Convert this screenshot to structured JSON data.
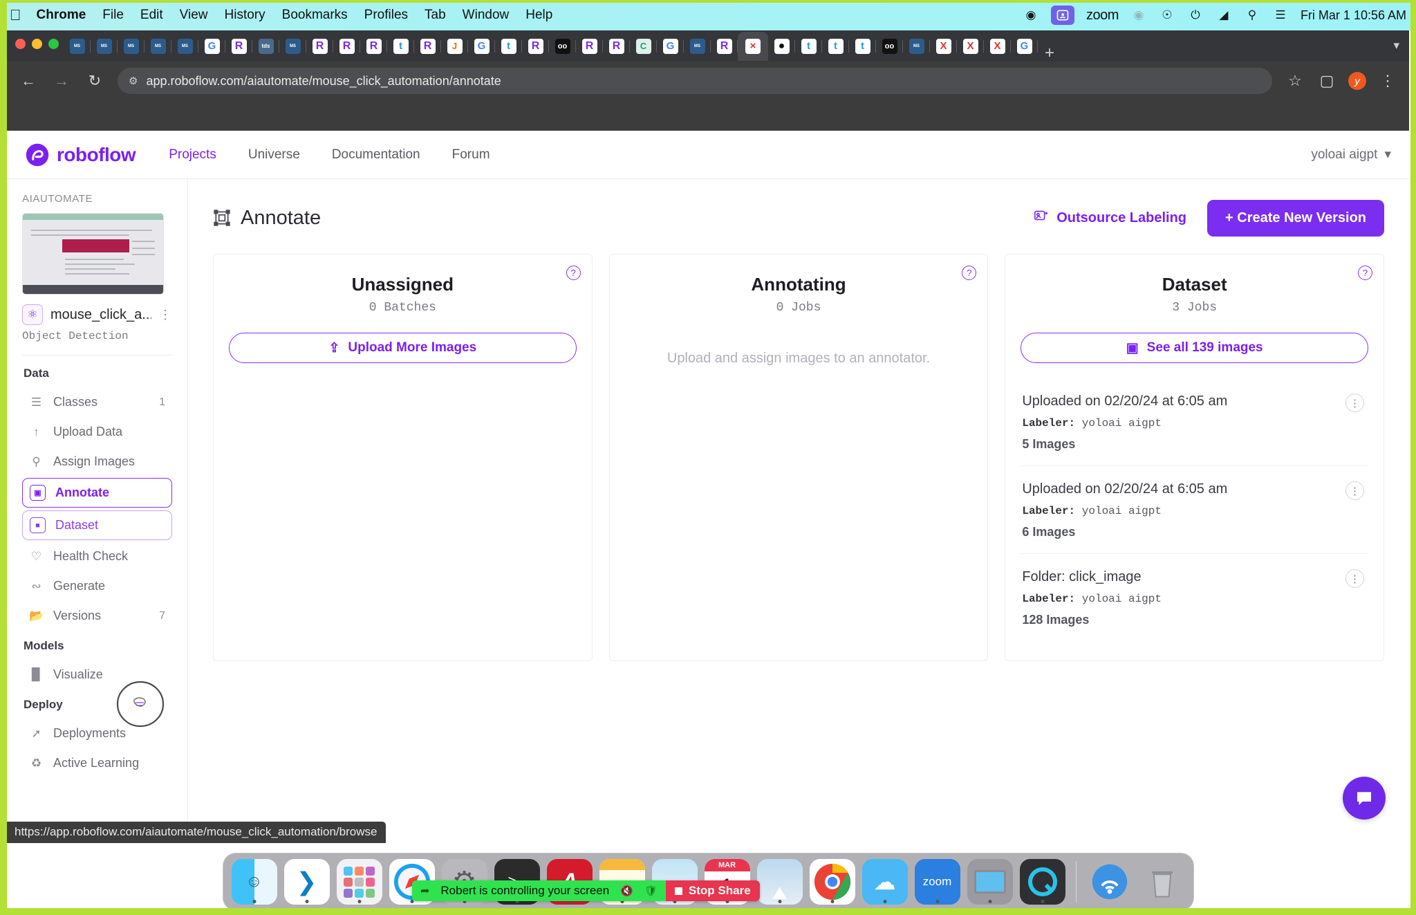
{
  "menubar": {
    "apple_icon": "apple-icon",
    "items": [
      "Chrome",
      "File",
      "Edit",
      "View",
      "History",
      "Bookmarks",
      "Profiles",
      "Tab",
      "Window",
      "Help"
    ],
    "zoom_label": "zoom",
    "clock": "Fri Mar 1  10:56 AM",
    "status_icons": [
      "dropbox-icon",
      "zoom-video-icon",
      "airplay-icon",
      "do-not-disturb-icon",
      "battery-icon",
      "wifi-icon",
      "search-icon",
      "control-center-icon"
    ]
  },
  "browser": {
    "back_icon": "back-arrow-icon",
    "forward_icon": "forward-arrow-icon",
    "reload_icon": "reload-icon",
    "site_info_icon": "site-settings-icon",
    "url": "app.roboflow.com/aiautomate/mouse_click_automation/annotate",
    "bookmark_icon": "star-icon",
    "sidepanel_icon": "side-panel-icon",
    "profile_initial": "y",
    "menu_icon": "three-dot-menu-icon",
    "new_tab_icon": "plus-icon",
    "tab_list_icon": "chevron-down-icon",
    "tabs": [
      {
        "favicon": "morgan-stanley-icon",
        "cls": "fv-ms",
        "glyph": "Morgan Stanley"
      },
      {
        "favicon": "morgan-stanley-icon",
        "cls": "fv-ms",
        "glyph": "Morgan Stanley"
      },
      {
        "favicon": "morgan-stanley-icon",
        "cls": "fv-ms",
        "glyph": "Morgan Stanley"
      },
      {
        "favicon": "morgan-stanley-icon",
        "cls": "fv-ms",
        "glyph": "Morgan Stanley"
      },
      {
        "favicon": "morgan-stanley-icon",
        "cls": "fv-ms",
        "glyph": "Morgan Stanley"
      },
      {
        "favicon": "google-icon",
        "cls": "fv-g",
        "glyph": "G"
      },
      {
        "favicon": "roboflow-icon",
        "cls": "fv-rf",
        "glyph": "R"
      },
      {
        "favicon": "tds-icon",
        "cls": "fv-tds",
        "glyph": "tds"
      },
      {
        "favicon": "morgan-stanley-icon",
        "cls": "fv-ms",
        "glyph": "Morgan Stanley"
      },
      {
        "favicon": "roboflow-icon",
        "cls": "fv-rf",
        "glyph": "R"
      },
      {
        "favicon": "roboflow-icon",
        "cls": "fv-rf",
        "glyph": "R"
      },
      {
        "favicon": "roboflow-icon",
        "cls": "fv-rf",
        "glyph": "R"
      },
      {
        "favicon": "twitter-icon",
        "cls": "fv-tw",
        "glyph": "t"
      },
      {
        "favicon": "roboflow-icon",
        "cls": "fv-rf",
        "glyph": "R"
      },
      {
        "favicon": "java-icon",
        "cls": "fv-java",
        "glyph": "J"
      },
      {
        "favicon": "google-icon",
        "cls": "fv-g",
        "glyph": "G"
      },
      {
        "favicon": "twitter-icon",
        "cls": "fv-tw",
        "glyph": "t"
      },
      {
        "favicon": "roboflow-icon",
        "cls": "fv-rf",
        "glyph": "R"
      },
      {
        "favicon": "dark-icon",
        "cls": "fv-dk",
        "glyph": "oo"
      },
      {
        "favicon": "roboflow-icon",
        "cls": "fv-rf",
        "glyph": "R"
      },
      {
        "favicon": "roboflow-icon",
        "cls": "fv-rf",
        "glyph": "R"
      },
      {
        "favicon": "chatgpt-icon",
        "cls": "fv-cg",
        "glyph": "C"
      },
      {
        "favicon": "google-icon",
        "cls": "fv-g",
        "glyph": "G"
      },
      {
        "favicon": "morgan-stanley-icon",
        "cls": "fv-ms",
        "glyph": "Morgan Stanley"
      },
      {
        "favicon": "roboflow-icon",
        "cls": "fv-rf",
        "glyph": "R"
      },
      {
        "favicon": "active-tab-icon",
        "cls": "fv-x",
        "glyph": "×",
        "active": true
      },
      {
        "favicon": "github-icon",
        "cls": "fv-gh",
        "glyph": "●"
      },
      {
        "favicon": "twitter-icon",
        "cls": "fv-tw",
        "glyph": "t"
      },
      {
        "favicon": "twitter-icon",
        "cls": "fv-tw",
        "glyph": "t"
      },
      {
        "favicon": "twitter-icon",
        "cls": "fv-tw",
        "glyph": "t"
      },
      {
        "favicon": "dark-icon",
        "cls": "fv-dk",
        "glyph": "oo"
      },
      {
        "favicon": "morgan-stanley-icon",
        "cls": "fv-ms",
        "glyph": "Morgan Stanley"
      },
      {
        "favicon": "x-icon",
        "cls": "fv-x",
        "glyph": "X"
      },
      {
        "favicon": "x-icon",
        "cls": "fv-x",
        "glyph": "X"
      },
      {
        "favicon": "x-icon",
        "cls": "fv-x",
        "glyph": "X"
      },
      {
        "favicon": "google-icon",
        "cls": "fv-g",
        "glyph": "G"
      }
    ]
  },
  "topnav": {
    "brand": "roboflow",
    "links": [
      {
        "label": "Projects",
        "active": true
      },
      {
        "label": "Universe",
        "active": false
      },
      {
        "label": "Documentation",
        "active": false
      },
      {
        "label": "Forum",
        "active": false
      }
    ],
    "user": "yoloai aigpt",
    "user_chevron": "chevron-down-icon"
  },
  "sidebar": {
    "org": "AIAUTOMATE",
    "project_name": "mouse_click_a...",
    "project_type": "Object Detection",
    "project_icon": "globe-icon",
    "project_menu_icon": "three-dot-menu-icon",
    "sections": [
      {
        "title": "Data",
        "items": [
          {
            "label": "Classes",
            "icon": "list-icon",
            "count": "1",
            "state": "normal"
          },
          {
            "label": "Upload Data",
            "icon": "upload-arrow-icon",
            "count": "",
            "state": "normal"
          },
          {
            "label": "Assign Images",
            "icon": "search-icon",
            "count": "",
            "state": "normal"
          },
          {
            "label": "Annotate",
            "icon": "annotate-box-icon",
            "count": "",
            "state": "selected"
          },
          {
            "label": "Dataset",
            "icon": "dataset-image-icon",
            "count": "",
            "state": "selected-soft"
          },
          {
            "label": "Health Check",
            "icon": "heartbeat-icon",
            "count": "",
            "state": "normal"
          },
          {
            "label": "Generate",
            "icon": "generate-layers-icon",
            "count": "",
            "state": "normal"
          },
          {
            "label": "Versions",
            "icon": "folder-icon",
            "count": "7",
            "state": "normal"
          }
        ]
      },
      {
        "title": "Models",
        "items": [
          {
            "label": "Visualize",
            "icon": "bar-chart-icon",
            "count": "",
            "state": "normal"
          }
        ]
      },
      {
        "title": "Deploy",
        "items": [
          {
            "label": "Deployments",
            "icon": "rocket-icon",
            "count": "",
            "state": "normal"
          },
          {
            "label": "Active Learning",
            "icon": "recycle-icon",
            "count": "",
            "state": "normal"
          }
        ]
      }
    ]
  },
  "main": {
    "page_title": "Annotate",
    "page_title_icon": "annotate-box-icon",
    "outsource_label": "Outsource Labeling",
    "outsource_icon": "outsource-icon",
    "create_version_label": "+ Create New Version",
    "cards": [
      {
        "title": "Unassigned",
        "subtitle": "0 Batches",
        "help_icon": "question-mark-icon",
        "action_label": "Upload More Images",
        "action_icon": "upload-box-icon",
        "empty_message": ""
      },
      {
        "title": "Annotating",
        "subtitle": "0 Jobs",
        "help_icon": "question-mark-icon",
        "action_label": "",
        "action_icon": "",
        "empty_message": "Upload and assign images to an annotator."
      },
      {
        "title": "Dataset",
        "subtitle": "3 Jobs",
        "help_icon": "question-mark-icon",
        "action_label": "See all 139 images",
        "action_icon": "images-icon",
        "empty_message": ""
      }
    ],
    "dataset_jobs": [
      {
        "title": "Uploaded on 02/20/24 at 6:05 am",
        "labeler_label": "Labeler:",
        "labeler": "yoloai aigpt",
        "count": "5 Images",
        "menu_icon": "three-dot-menu-icon"
      },
      {
        "title": "Uploaded on 02/20/24 at 6:05 am",
        "labeler_label": "Labeler:",
        "labeler": "yoloai aigpt",
        "count": "6 Images",
        "menu_icon": "three-dot-menu-icon"
      },
      {
        "title": "Folder: click_image",
        "labeler_label": "Labeler:",
        "labeler": "yoloai aigpt",
        "count": "128 Images",
        "menu_icon": "three-dot-menu-icon"
      }
    ],
    "chat_icon": "chat-bubble-icon"
  },
  "statusbar": {
    "url": "https://app.roboflow.com/aiautomate/mouse_click_automation/browse"
  },
  "dock": {
    "items": [
      {
        "name": "finder-icon",
        "bg": "#2aa8f2",
        "glyph": ""
      },
      {
        "name": "vscode-icon",
        "bg": "#ffffff",
        "glyph": ""
      },
      {
        "name": "launchpad-icon",
        "bg": "#f2f2f4",
        "glyph": ""
      },
      {
        "name": "safari-icon",
        "bg": "#ffffff",
        "glyph": ""
      },
      {
        "name": "system-settings-icon",
        "bg": "#b9b9bd",
        "glyph": ""
      },
      {
        "name": "terminal-icon",
        "bg": "#2b2b2b",
        "glyph": ">_"
      },
      {
        "name": "adobe-acrobat-icon",
        "bg": "#d41b2c",
        "glyph": "A"
      },
      {
        "name": "notes-icon",
        "bg": "#fdf3c8",
        "glyph": ""
      },
      {
        "name": "preview-icon",
        "bg": "#cfe6f7",
        "glyph": ""
      },
      {
        "name": "calendar-icon",
        "bg": "#ffffff",
        "glyph": "1"
      },
      {
        "name": "photos-icon",
        "bg": "#dceaf5",
        "glyph": ""
      },
      {
        "name": "chrome-icon",
        "bg": "#ffffff",
        "glyph": ""
      },
      {
        "name": "weather-icon",
        "bg": "#45b6f5",
        "glyph": ""
      },
      {
        "name": "zoom-icon",
        "bg": "#2a7fe0",
        "glyph": "zoom"
      },
      {
        "name": "display-icon",
        "bg": "#9a9aa0",
        "glyph": ""
      },
      {
        "name": "quicktime-icon",
        "bg": "#2e2e33",
        "glyph": ""
      },
      {
        "name": "airdrop-icon",
        "bg": "transparent",
        "glyph": ""
      },
      {
        "name": "trash-icon",
        "bg": "transparent",
        "glyph": ""
      }
    ],
    "calendar_month": "MAR",
    "calendar_day": "1",
    "zoom_label": "zoom"
  },
  "sharebar": {
    "message": "Robert is controlling your screen",
    "mic_icon": "mic-muted-icon",
    "shield_icon": "shield-icon",
    "stop_label": "Stop Share",
    "remote_icon": "remote-control-icon"
  },
  "colors": {
    "accent": "#7b2ef0",
    "accent_soft": "#c9a3f2",
    "green_edge": "#b2e035",
    "share_green": "#2fe34f",
    "share_red": "#e8344e"
  }
}
